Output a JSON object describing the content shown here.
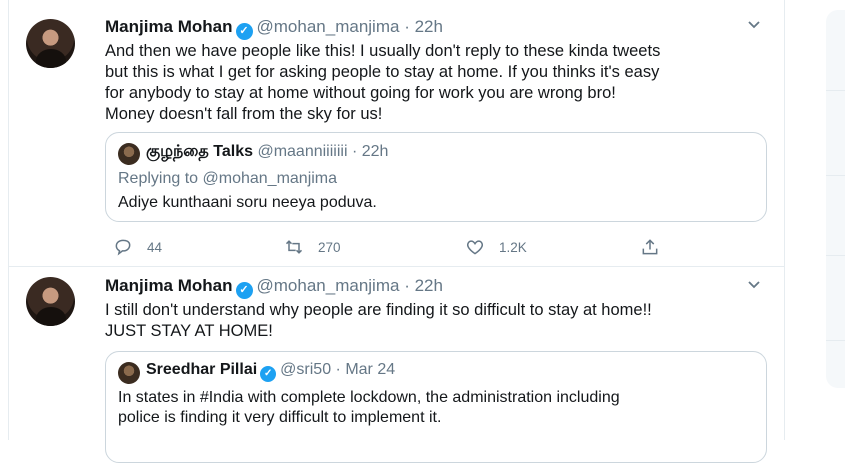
{
  "tweets": [
    {
      "author_name": "Manjima Mohan",
      "handle": "@mohan_manjima",
      "separator": "·",
      "time": "22h",
      "text_lines": [
        "And then we have people like this! I usually don't reply to these kinda tweets",
        "but this is what I get for asking people to stay at home. If you thinks it's easy",
        "for anybody to stay at home without going for work you are wrong bro!",
        "Money doesn't fall from the sky for us!"
      ],
      "quote": {
        "author_name": "குழந்தை Talks",
        "handle": "@maanniiiiiii",
        "separator": "·",
        "time": "22h",
        "replying_label": "Replying to",
        "replying_handle": "@mohan_manjima",
        "text": "Adiye kunthaani soru neeya poduva."
      },
      "actions": {
        "replies": "44",
        "retweets": "270",
        "likes": "1.2K"
      }
    },
    {
      "author_name": "Manjima Mohan",
      "handle": "@mohan_manjima",
      "separator": "·",
      "time": "22h",
      "text_lines": [
        "I still don't understand why people are finding it so difficult to stay at home!!",
        "JUST STAY AT HOME!"
      ],
      "quote": {
        "author_name": "Sreedhar Pillai",
        "handle": "@sri50",
        "separator": "·",
        "time": "Mar 24",
        "text_lines": [
          "In states in #India with complete lockdown, the administration including",
          "police is finding it very difficult to implement it."
        ]
      }
    }
  ],
  "colors": {
    "accent": "#1da1f2",
    "secondary_text": "#657786",
    "border": "#e6ecf0"
  },
  "icons": [
    "reply-icon",
    "retweet-icon",
    "like-icon",
    "share-icon",
    "verified-badge-icon",
    "chevron-down-icon"
  ]
}
